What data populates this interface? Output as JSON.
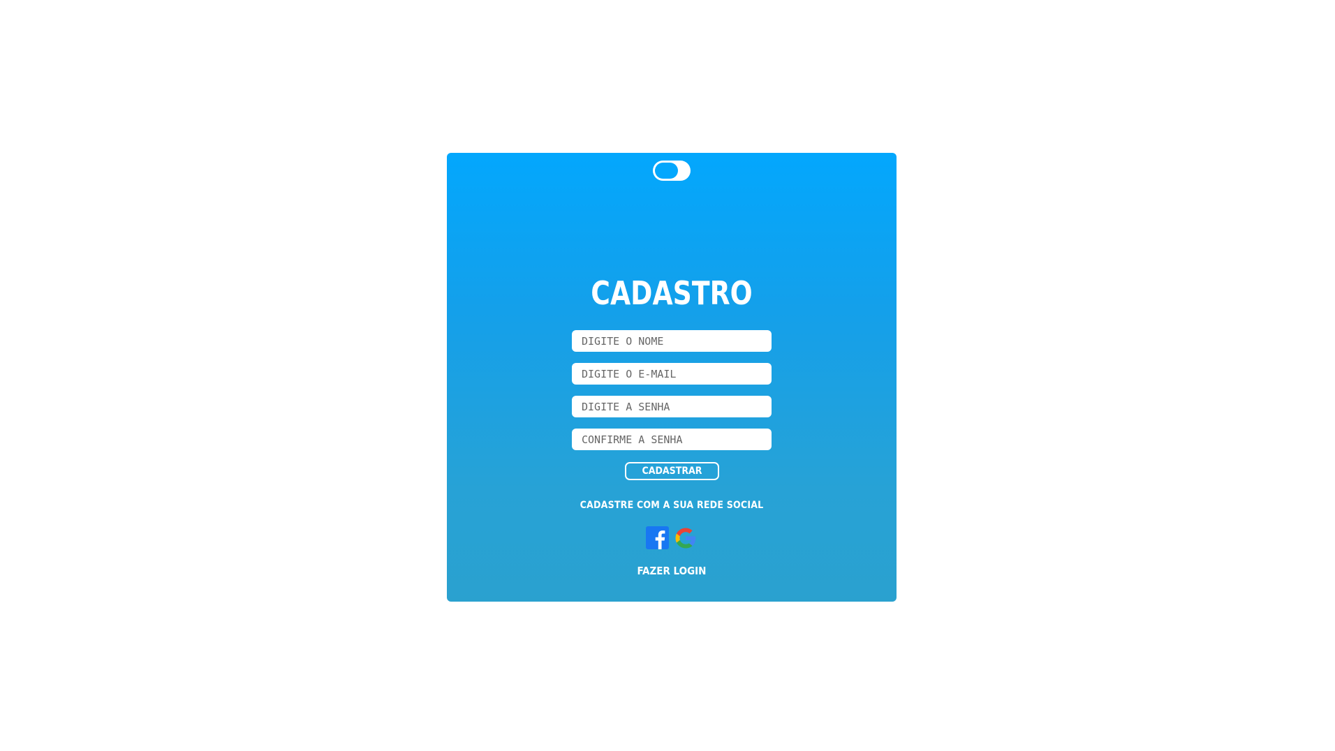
{
  "title": "CADASTRO",
  "fields": {
    "name_placeholder": "DIGITE O NOME",
    "email_placeholder": "DIGITE O E-MAIL",
    "password_placeholder": "DIGITE A SENHA",
    "confirm_placeholder": "CONFIRME A SENHA"
  },
  "submit_label": "CADASTRAR",
  "social_text": "CADASTRE COM A SUA REDE SOCIAL",
  "login_link": "FAZER LOGIN",
  "icons": {
    "facebook": "facebook-icon",
    "google": "google-icon"
  },
  "colors": {
    "gradient_top": "#03a7fd",
    "gradient_bottom": "#2aa1cf",
    "facebook": "#1877f2",
    "white": "#ffffff"
  },
  "theme_toggle": {
    "state": "off"
  }
}
